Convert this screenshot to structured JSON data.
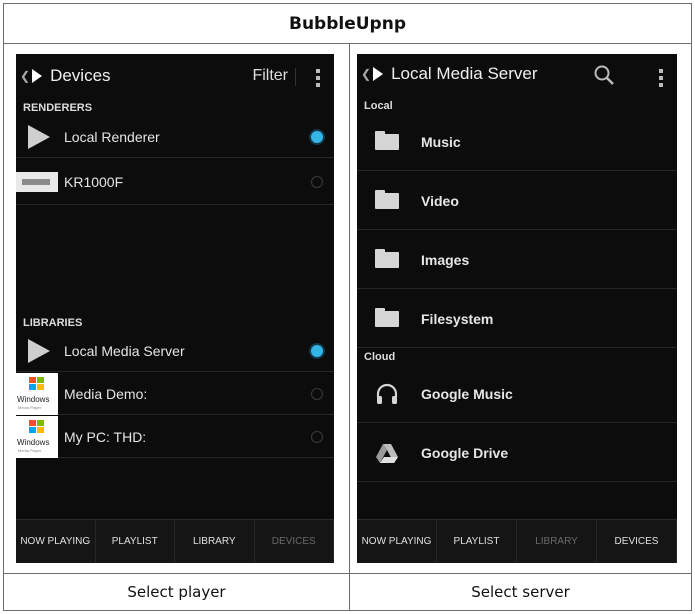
{
  "title": "BubbleUpnp",
  "captions": {
    "left": "Select player",
    "right": "Select server"
  },
  "left_screen": {
    "actionbar": {
      "title": "Devices",
      "filter": "Filter"
    },
    "renderers_header": "RENDERERS",
    "renderers": [
      {
        "label": "Local Renderer",
        "selected": true,
        "icon": "play-icon"
      },
      {
        "label": "KR1000F",
        "selected": false,
        "icon": "device-icon"
      }
    ],
    "libraries_header": "LIBRARIES",
    "libraries": [
      {
        "label": "Local Media Server",
        "selected": true,
        "icon": "play-icon"
      },
      {
        "label": "Media Demo:",
        "selected": false,
        "icon": "windows-media-player-icon"
      },
      {
        "label": "My PC:  THD:",
        "selected": false,
        "icon": "windows-media-player-icon"
      }
    ],
    "wmp_logo_text": "Windows",
    "wmp_logo_sub": "Media Player",
    "tabs": [
      {
        "label": "NOW PLAYING",
        "dim": false
      },
      {
        "label": "PLAYLIST",
        "dim": false
      },
      {
        "label": "LIBRARY",
        "dim": false
      },
      {
        "label": "DEVICES",
        "dim": true
      }
    ]
  },
  "right_screen": {
    "actionbar": {
      "title": "Local Media Server"
    },
    "local_header": "Local",
    "local_items": [
      "Music",
      "Video",
      "Images",
      "Filesystem"
    ],
    "cloud_header": "Cloud",
    "cloud_items": [
      {
        "label": "Google Music",
        "icon": "headphones-icon"
      },
      {
        "label": "Google Drive",
        "icon": "google-drive-icon"
      }
    ],
    "tabs": [
      {
        "label": "NOW PLAYING",
        "dim": false
      },
      {
        "label": "PLAYLIST",
        "dim": false
      },
      {
        "label": "LIBRARY",
        "dim": true
      },
      {
        "label": "DEVICES",
        "dim": false
      }
    ]
  },
  "colors": {
    "accent": "#34b5e5",
    "screen_bg": "#0c0c0c"
  }
}
